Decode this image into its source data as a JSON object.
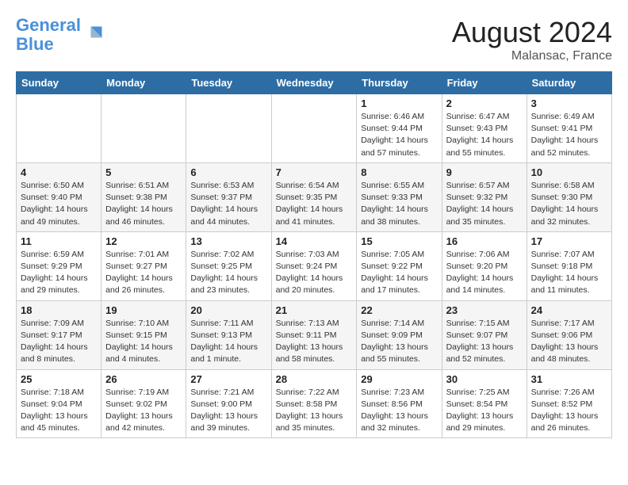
{
  "header": {
    "logo_line1": "General",
    "logo_line2": "Blue",
    "month": "August 2024",
    "location": "Malansac, France"
  },
  "weekdays": [
    "Sunday",
    "Monday",
    "Tuesday",
    "Wednesday",
    "Thursday",
    "Friday",
    "Saturday"
  ],
  "weeks": [
    [
      {
        "day": "",
        "detail": ""
      },
      {
        "day": "",
        "detail": ""
      },
      {
        "day": "",
        "detail": ""
      },
      {
        "day": "",
        "detail": ""
      },
      {
        "day": "1",
        "detail": "Sunrise: 6:46 AM\nSunset: 9:44 PM\nDaylight: 14 hours\nand 57 minutes."
      },
      {
        "day": "2",
        "detail": "Sunrise: 6:47 AM\nSunset: 9:43 PM\nDaylight: 14 hours\nand 55 minutes."
      },
      {
        "day": "3",
        "detail": "Sunrise: 6:49 AM\nSunset: 9:41 PM\nDaylight: 14 hours\nand 52 minutes."
      }
    ],
    [
      {
        "day": "4",
        "detail": "Sunrise: 6:50 AM\nSunset: 9:40 PM\nDaylight: 14 hours\nand 49 minutes."
      },
      {
        "day": "5",
        "detail": "Sunrise: 6:51 AM\nSunset: 9:38 PM\nDaylight: 14 hours\nand 46 minutes."
      },
      {
        "day": "6",
        "detail": "Sunrise: 6:53 AM\nSunset: 9:37 PM\nDaylight: 14 hours\nand 44 minutes."
      },
      {
        "day": "7",
        "detail": "Sunrise: 6:54 AM\nSunset: 9:35 PM\nDaylight: 14 hours\nand 41 minutes."
      },
      {
        "day": "8",
        "detail": "Sunrise: 6:55 AM\nSunset: 9:33 PM\nDaylight: 14 hours\nand 38 minutes."
      },
      {
        "day": "9",
        "detail": "Sunrise: 6:57 AM\nSunset: 9:32 PM\nDaylight: 14 hours\nand 35 minutes."
      },
      {
        "day": "10",
        "detail": "Sunrise: 6:58 AM\nSunset: 9:30 PM\nDaylight: 14 hours\nand 32 minutes."
      }
    ],
    [
      {
        "day": "11",
        "detail": "Sunrise: 6:59 AM\nSunset: 9:29 PM\nDaylight: 14 hours\nand 29 minutes."
      },
      {
        "day": "12",
        "detail": "Sunrise: 7:01 AM\nSunset: 9:27 PM\nDaylight: 14 hours\nand 26 minutes."
      },
      {
        "day": "13",
        "detail": "Sunrise: 7:02 AM\nSunset: 9:25 PM\nDaylight: 14 hours\nand 23 minutes."
      },
      {
        "day": "14",
        "detail": "Sunrise: 7:03 AM\nSunset: 9:24 PM\nDaylight: 14 hours\nand 20 minutes."
      },
      {
        "day": "15",
        "detail": "Sunrise: 7:05 AM\nSunset: 9:22 PM\nDaylight: 14 hours\nand 17 minutes."
      },
      {
        "day": "16",
        "detail": "Sunrise: 7:06 AM\nSunset: 9:20 PM\nDaylight: 14 hours\nand 14 minutes."
      },
      {
        "day": "17",
        "detail": "Sunrise: 7:07 AM\nSunset: 9:18 PM\nDaylight: 14 hours\nand 11 minutes."
      }
    ],
    [
      {
        "day": "18",
        "detail": "Sunrise: 7:09 AM\nSunset: 9:17 PM\nDaylight: 14 hours\nand 8 minutes."
      },
      {
        "day": "19",
        "detail": "Sunrise: 7:10 AM\nSunset: 9:15 PM\nDaylight: 14 hours\nand 4 minutes."
      },
      {
        "day": "20",
        "detail": "Sunrise: 7:11 AM\nSunset: 9:13 PM\nDaylight: 14 hours\nand 1 minute."
      },
      {
        "day": "21",
        "detail": "Sunrise: 7:13 AM\nSunset: 9:11 PM\nDaylight: 13 hours\nand 58 minutes."
      },
      {
        "day": "22",
        "detail": "Sunrise: 7:14 AM\nSunset: 9:09 PM\nDaylight: 13 hours\nand 55 minutes."
      },
      {
        "day": "23",
        "detail": "Sunrise: 7:15 AM\nSunset: 9:07 PM\nDaylight: 13 hours\nand 52 minutes."
      },
      {
        "day": "24",
        "detail": "Sunrise: 7:17 AM\nSunset: 9:06 PM\nDaylight: 13 hours\nand 48 minutes."
      }
    ],
    [
      {
        "day": "25",
        "detail": "Sunrise: 7:18 AM\nSunset: 9:04 PM\nDaylight: 13 hours\nand 45 minutes."
      },
      {
        "day": "26",
        "detail": "Sunrise: 7:19 AM\nSunset: 9:02 PM\nDaylight: 13 hours\nand 42 minutes."
      },
      {
        "day": "27",
        "detail": "Sunrise: 7:21 AM\nSunset: 9:00 PM\nDaylight: 13 hours\nand 39 minutes."
      },
      {
        "day": "28",
        "detail": "Sunrise: 7:22 AM\nSunset: 8:58 PM\nDaylight: 13 hours\nand 35 minutes."
      },
      {
        "day": "29",
        "detail": "Sunrise: 7:23 AM\nSunset: 8:56 PM\nDaylight: 13 hours\nand 32 minutes."
      },
      {
        "day": "30",
        "detail": "Sunrise: 7:25 AM\nSunset: 8:54 PM\nDaylight: 13 hours\nand 29 minutes."
      },
      {
        "day": "31",
        "detail": "Sunrise: 7:26 AM\nSunset: 8:52 PM\nDaylight: 13 hours\nand 26 minutes."
      }
    ]
  ]
}
